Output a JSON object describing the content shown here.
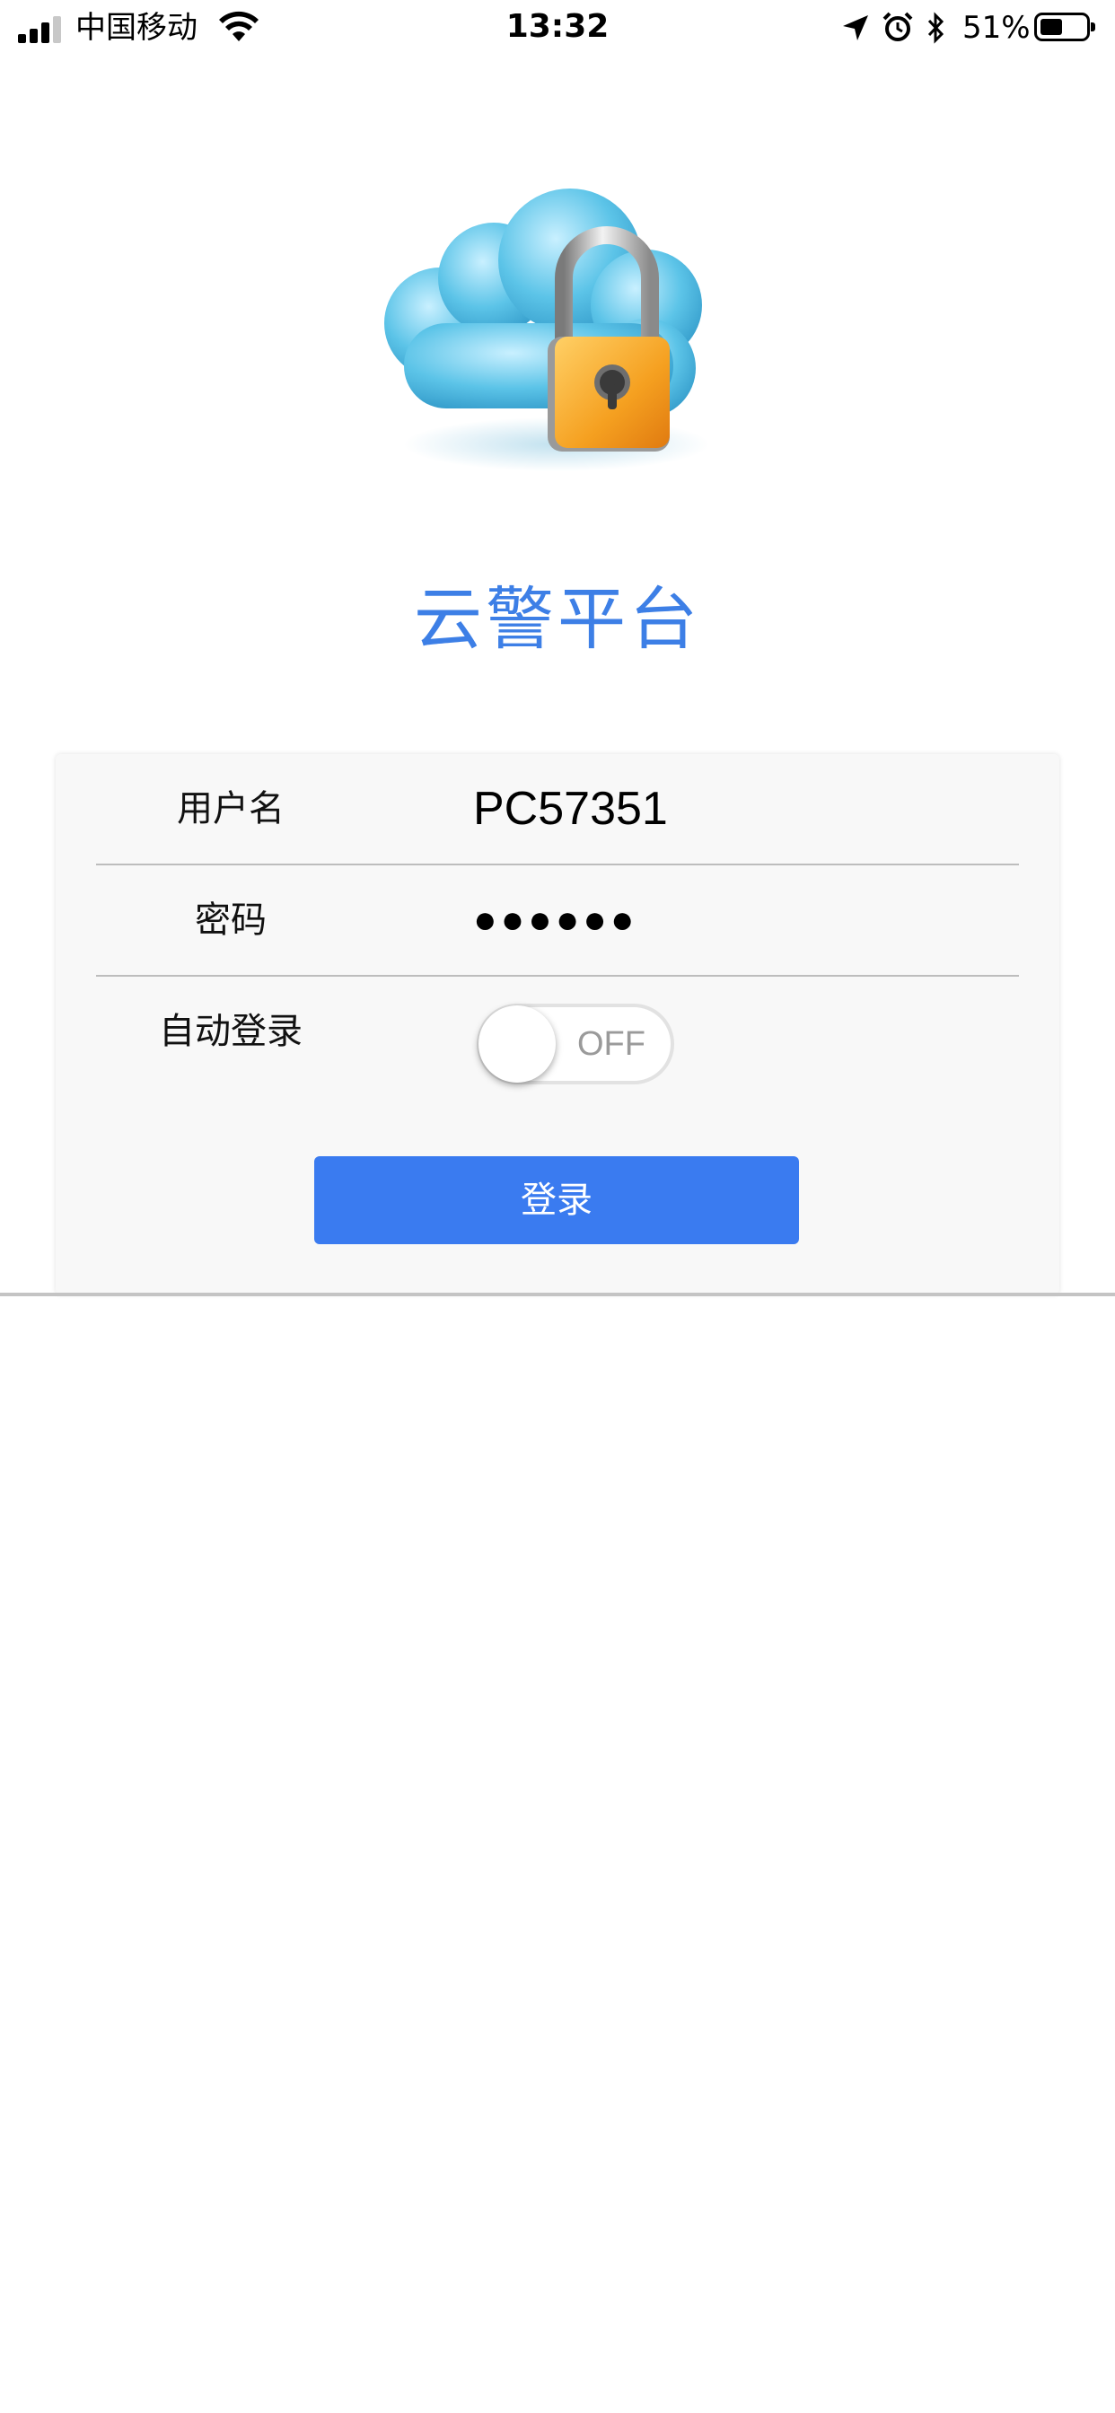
{
  "status_bar": {
    "carrier": "中国移动",
    "time": "13:32",
    "battery_percent_label": "51%",
    "battery_level": 0.51,
    "icons": [
      "signal-icon",
      "wifi-icon",
      "location-icon",
      "alarm-icon",
      "bluetooth-icon",
      "battery-icon"
    ]
  },
  "app": {
    "title": "云警平台",
    "logo_icon": "cloud-lock-icon"
  },
  "login_form": {
    "username_label": "用户名",
    "username_value": "PC57351",
    "password_label": "密码",
    "password_value": "●●●●●●",
    "auto_login_label": "自动登录",
    "auto_login_state": "OFF",
    "login_button": "登录"
  },
  "colors": {
    "accent": "#3d7fe6",
    "button": "#3a7bf0",
    "card_bg": "#f8f8f8",
    "lock_orange": "#f5a020",
    "cloud_blue": "#5cc4e8"
  }
}
